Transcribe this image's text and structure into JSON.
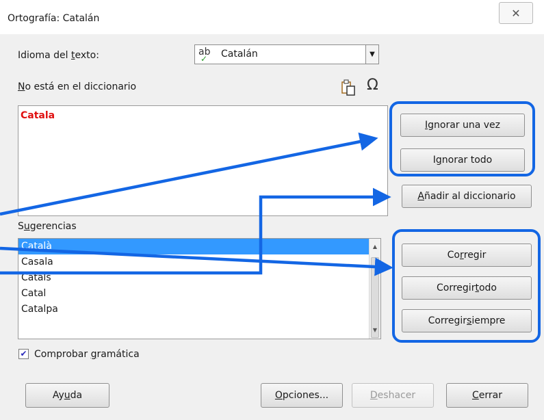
{
  "window": {
    "title": "Ortografía: Catalán",
    "close_glyph": "✕"
  },
  "language": {
    "label_pre": "Idioma del ",
    "label_u": "t",
    "label_post": "exto:",
    "value": "Catalán",
    "icon_text": "ab",
    "check_glyph": "✓",
    "arrow_glyph": "▼"
  },
  "not_in_dictionary": {
    "label_u": "N",
    "label_post": "o está en el diccionario",
    "word": "Catala",
    "word_color": "#e01010"
  },
  "tools": {
    "omega": "Ω"
  },
  "buttons": {
    "ignore_once": {
      "u": "I",
      "rest": "gnorar una vez"
    },
    "ignore_all": {
      "pre": "I",
      "u": "g",
      "rest": "norar todo"
    },
    "add_dict": {
      "u": "A",
      "rest": "ñadir al diccionario"
    },
    "correct": {
      "pre": "Co",
      "u": "r",
      "rest": "regir"
    },
    "correct_all": {
      "pre": "Corregir ",
      "u": "t",
      "rest": "odo"
    },
    "correct_always": {
      "pre": "Corregir ",
      "u": "s",
      "rest": "iempre"
    }
  },
  "suggestions": {
    "label_pre": "S",
    "label_u": "u",
    "label_post": "gerencias",
    "items": [
      "Català",
      "Casala",
      "Catals",
      "Catal",
      "Catalpa"
    ],
    "selected_index": 0
  },
  "grammar": {
    "checked": true,
    "check_glyph": "✔",
    "label_pre": "Comprobar ",
    "label_u": "g",
    "label_post": "ramática"
  },
  "footer": {
    "help": {
      "pre": "Ay",
      "u": "u",
      "rest": "da"
    },
    "options": {
      "u": "O",
      "rest": "pciones..."
    },
    "undo": {
      "u": "D",
      "rest": "eshacer"
    },
    "close": {
      "u": "C",
      "rest": "errar"
    }
  },
  "colors": {
    "highlight": "#1366e4",
    "selection": "#3399ff"
  }
}
